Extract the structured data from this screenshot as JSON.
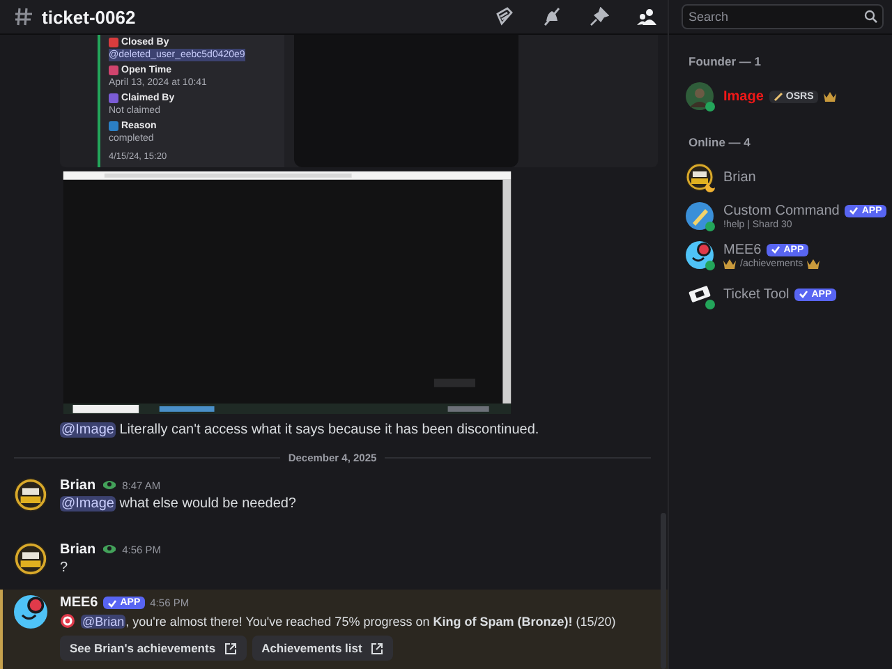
{
  "channel": {
    "name": "ticket-0062"
  },
  "search": {
    "placeholder": "Search"
  },
  "embed": {
    "fields": [
      {
        "name": "Closed By",
        "value": "@deleted_user_eebc5d0420e9",
        "kind": "mention",
        "color": "#d83c3e"
      },
      {
        "name": "Open Time",
        "value": "April 13, 2024 at 10:41",
        "kind": "text",
        "color": "#d0446e"
      },
      {
        "name": "Claimed By",
        "value": "Not claimed",
        "kind": "text",
        "color": "#7b5cd6"
      },
      {
        "name": "Reason",
        "value": "completed",
        "kind": "text",
        "color": "#2b7fc4"
      }
    ],
    "footer": "4/15/24, 15:20"
  },
  "continued": {
    "mention": "@Image",
    "text": "Literally can't access what it says because it has been discontinued."
  },
  "divider": "December 4, 2025",
  "messages": [
    {
      "author": "Brian",
      "time": "8:47 AM",
      "mention": "@Image",
      "text": "what else would be needed?"
    },
    {
      "author": "Brian",
      "time": "4:56 PM",
      "text": "?"
    }
  ],
  "bot_message": {
    "author": "MEE6",
    "tag": "APP",
    "time": "4:56 PM",
    "mention": "@Brian",
    "text": ", you're almost there! You've reached 75% progress on **King of Spam (Bronze)!** (15/20)",
    "highlighted": true,
    "buttons": [
      "See Brian's achievements",
      "Achievements list"
    ]
  },
  "member_groups": [
    {
      "title": "Founder — 1",
      "members": [
        {
          "name": "Image",
          "kind": "person",
          "idle": false,
          "color": "#f01818",
          "role_tag": "OSRS",
          "crown": true
        }
      ]
    },
    {
      "title": "Online — 4",
      "members": [
        {
          "name": "Brian",
          "kind": "badger",
          "idle": true
        },
        {
          "name": "Custom Command",
          "kind": "pencil",
          "idle": false,
          "tag": "APP",
          "activity": "!help | Shard 30"
        },
        {
          "name": "MEE6",
          "kind": "mee6",
          "idle": false,
          "tag": "APP",
          "activity": "/achievements"
        },
        {
          "name": "Ticket Tool",
          "kind": "ticket",
          "idle": false,
          "tag": "APP"
        }
      ]
    }
  ]
}
